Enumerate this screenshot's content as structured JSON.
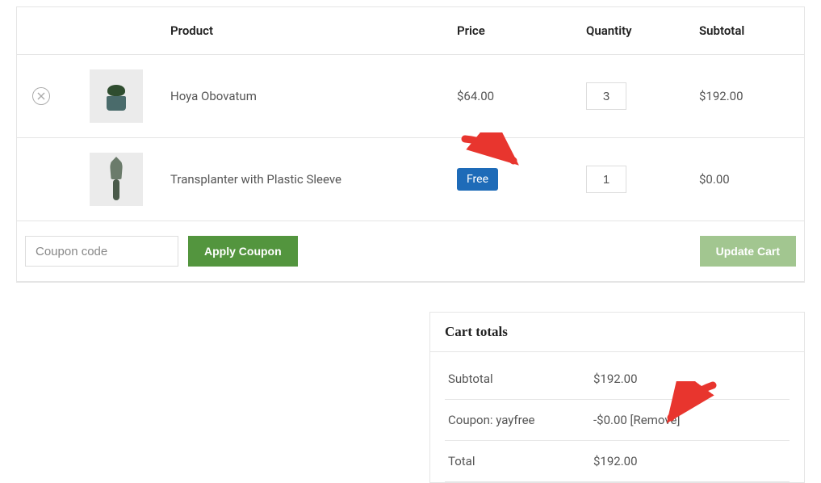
{
  "headers": {
    "product": "Product",
    "price": "Price",
    "quantity": "Quantity",
    "subtotal": "Subtotal"
  },
  "items": [
    {
      "name": "Hoya Obovatum",
      "price": "$64.00",
      "price_is_badge": false,
      "qty": "3",
      "subtotal": "$192.00",
      "icon": "plant"
    },
    {
      "name": "Transplanter with Plastic Sleeve",
      "price": "Free",
      "price_is_badge": true,
      "qty": "1",
      "subtotal": "$0.00",
      "icon": "trowel"
    }
  ],
  "coupon": {
    "placeholder": "Coupon code",
    "apply_label": "Apply Coupon",
    "update_label": "Update Cart"
  },
  "totals": {
    "title": "Cart totals",
    "subtotal_label": "Subtotal",
    "subtotal_value": "$192.00",
    "coupon_label": "Coupon: yayfree",
    "coupon_value": "-$0.00 ",
    "remove_label": "[Remove]",
    "total_label": "Total",
    "total_value": "$192.00"
  }
}
